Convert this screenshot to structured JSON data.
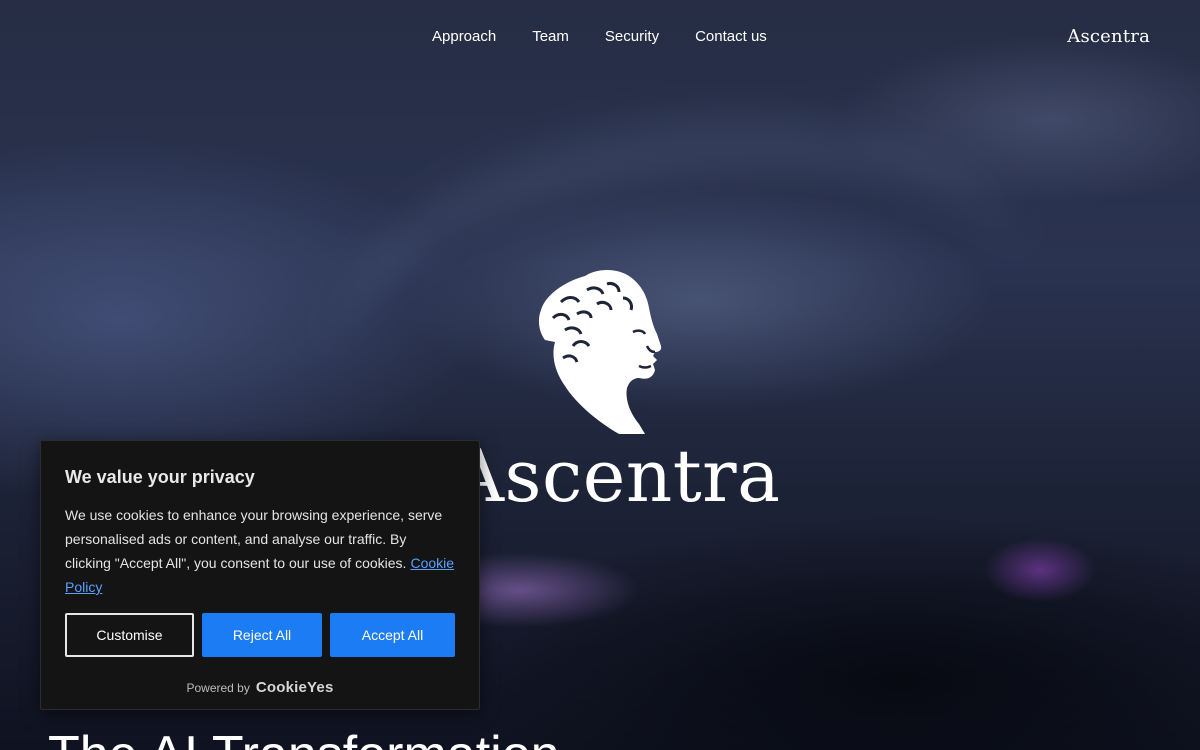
{
  "nav": {
    "items": [
      {
        "label": "Approach"
      },
      {
        "label": "Team"
      },
      {
        "label": "Security"
      },
      {
        "label": "Contact us"
      }
    ],
    "brand": "Ascentra"
  },
  "hero": {
    "logo_icon": "classical-head-icon",
    "wordmark": "Ascentra",
    "headline": "The AI Transformation"
  },
  "cookie_banner": {
    "title": "We value your privacy",
    "body": "We use cookies to enhance your browsing experience, serve personalised ads or content, and analyse our traffic. By clicking \"Accept All\", you consent to our use of cookies.",
    "link_label": "Cookie Policy",
    "buttons": {
      "customise": "Customise",
      "reject": "Reject All",
      "accept": "Accept All"
    },
    "powered_by": "Powered by",
    "vendor": "CookieYes"
  },
  "colors": {
    "primary_button": "#1b7cf3",
    "link": "#5aa0ff",
    "banner_bg": "#141414"
  }
}
